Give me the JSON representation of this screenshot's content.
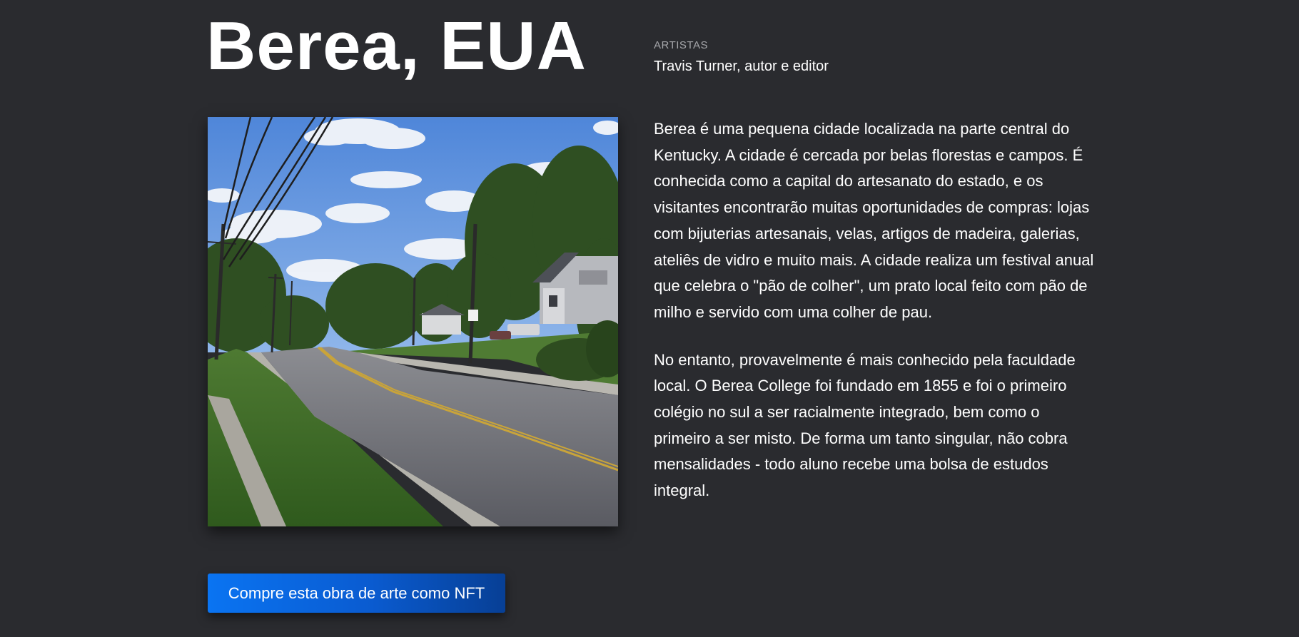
{
  "header": {
    "title": "Berea, EUA",
    "artists_label": "ARTISTAS",
    "artists_name": "Travis Turner, autor e editor"
  },
  "image": {
    "subject": "street-road-photo"
  },
  "description": {
    "paragraphs": [
      "Berea é uma pequena cidade localizada na parte central do Kentucky. A cidade é cercada por belas florestas e campos. É conhecida como a capital do artesanato do estado, e os visitantes encontrarão muitas oportunidades de compras: lojas com bijuterias artesanais, velas, artigos de madeira, galerias, ateliês de vidro e muito mais. A cidade realiza um festival anual que celebra o \"pão de colher\", um prato local feito com pão de milho e servido com uma colher de pau.",
      "No entanto, provavelmente é mais conhecido pela faculdade local. O Berea College foi fundado em 1855 e foi o primeiro colégio no sul a ser racialmente integrado, bem como o primeiro a ser misto. De forma um tanto singular, não cobra mensalidades - todo aluno recebe uma bolsa de estudos integral."
    ]
  },
  "actions": {
    "buy_nft_label": "Compre esta obra de arte como NFT"
  },
  "colors": {
    "background": "#2a2b2f",
    "button_start": "#0a74f2",
    "button_end": "#073f95",
    "muted_text": "#a6a7ab"
  }
}
